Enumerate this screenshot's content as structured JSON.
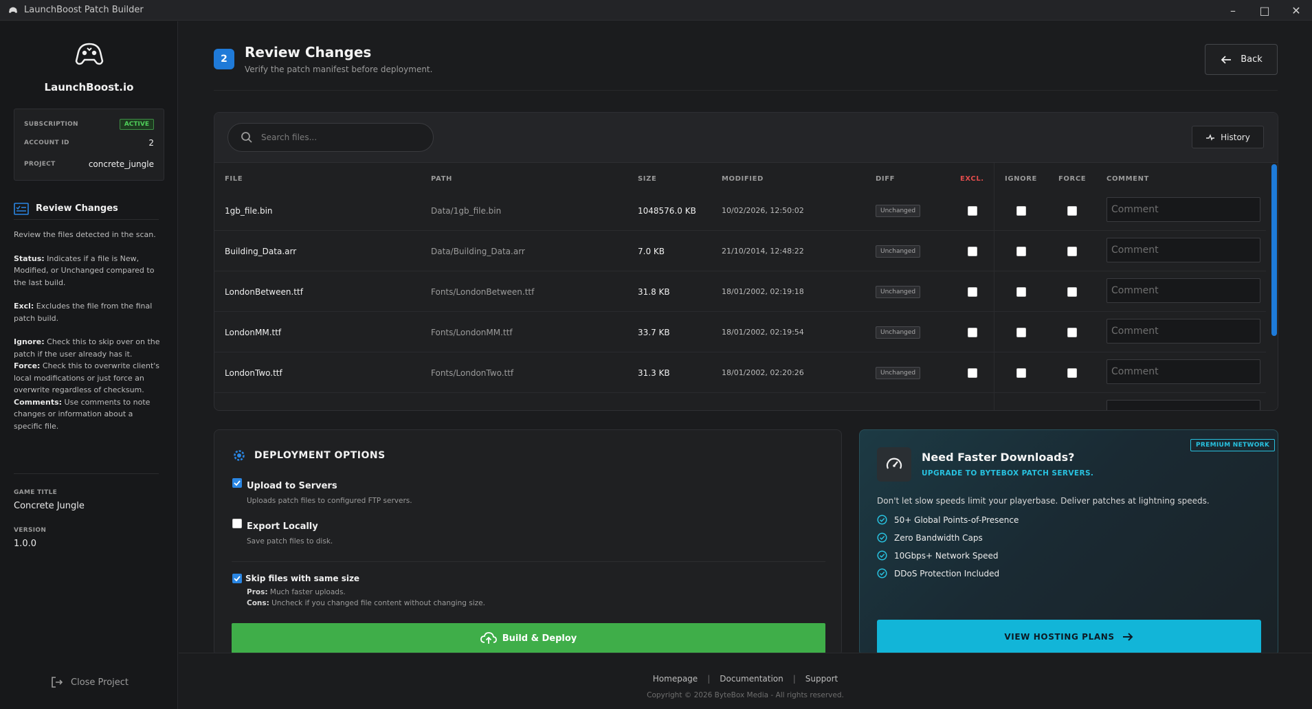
{
  "window": {
    "title": "LaunchBoost Patch Builder"
  },
  "sidebar": {
    "brand": "LaunchBoost.io",
    "subscription": {
      "label": "SUBSCRIPTION",
      "status": "ACTIVE"
    },
    "account": {
      "label": "ACCOUNT ID",
      "value": "2"
    },
    "project": {
      "label": "PROJECT",
      "value": "concrete_jungle"
    },
    "nav_active": "Review Changes",
    "help": {
      "intro": "Review the files detected in the scan.",
      "status_k": "Status:",
      "status_v": " Indicates if a file is New, Modified, or Unchanged compared to the last build.",
      "excl_k": "Excl:",
      "excl_v": " Excludes the file from the final patch build.",
      "ignore_k": "Ignore:",
      "ignore_v": " Check this to skip over on the patch if the user already has it.",
      "force_k": "Force:",
      "force_v": " Check this to overwrite client's local modifications or just force an overwrite regardless of checksum.",
      "comments_k": "Comments:",
      "comments_v": " Use comments to note changes or information about a specific file."
    },
    "game_title_label": "GAME TITLE",
    "game_title": "Concrete Jungle",
    "version_label": "VERSION",
    "version": "1.0.0",
    "close_project": "Close Project"
  },
  "header": {
    "step": "2",
    "title": "Review Changes",
    "subtitle": "Verify the patch manifest before deployment.",
    "back": "Back"
  },
  "files": {
    "search_placeholder": "Search files...",
    "history": "History",
    "columns": [
      "FILE",
      "PATH",
      "SIZE",
      "MODIFIED",
      "DIFF",
      "EXCL.",
      "IGNORE",
      "FORCE",
      "COMMENT"
    ],
    "comment_placeholder": "Comment",
    "rows": [
      {
        "file": "1gb_file.bin",
        "path": "Data/1gb_file.bin",
        "size": "1048576.0 KB",
        "modified": "10/02/2026, 12:50:02",
        "diff": "Unchanged"
      },
      {
        "file": "Building_Data.arr",
        "path": "Data/Building_Data.arr",
        "size": "7.0 KB",
        "modified": "21/10/2014, 12:48:22",
        "diff": "Unchanged"
      },
      {
        "file": "LondonBetween.ttf",
        "path": "Fonts/LondonBetween.ttf",
        "size": "31.8 KB",
        "modified": "18/01/2002, 02:19:18",
        "diff": "Unchanged"
      },
      {
        "file": "LondonMM.ttf",
        "path": "Fonts/LondonMM.ttf",
        "size": "33.7 KB",
        "modified": "18/01/2002, 02:19:54",
        "diff": "Unchanged"
      },
      {
        "file": "LondonTwo.ttf",
        "path": "Fonts/LondonTwo.ttf",
        "size": "31.3 KB",
        "modified": "18/01/2002, 02:20:26",
        "diff": "Unchanged"
      }
    ]
  },
  "deployment": {
    "title": "DEPLOYMENT OPTIONS",
    "upload": {
      "label": "Upload to Servers",
      "desc": "Uploads patch files to configured FTP servers.",
      "checked": true
    },
    "export": {
      "label": "Export Locally",
      "desc": "Save patch files to disk.",
      "checked": false
    },
    "skip": {
      "label": "Skip files with same size",
      "pros_k": "Pros:",
      "pros_v": " Much faster uploads.",
      "cons_k": "Cons:",
      "cons_v": " Uncheck if you changed file content without changing size.",
      "checked": true
    },
    "build": "Build & Deploy"
  },
  "promo": {
    "badge": "PREMIUM NETWORK",
    "title": "Need Faster Downloads?",
    "subtitle": "UPGRADE TO BYTEBOX PATCH SERVERS.",
    "desc": "Don't let slow speeds limit your playerbase. Deliver patches at lightning speeds.",
    "features": [
      "50+ Global Points-of-Presence",
      "Zero Bandwidth Caps",
      "10Gbps+ Network Speed",
      "DDoS Protection Included"
    ],
    "cta": "VIEW HOSTING PLANS"
  },
  "footer": {
    "links": [
      "Homepage",
      "Documentation",
      "Support"
    ],
    "copyright": "Copyright © 2026 ByteBox Media - All rights reserved."
  },
  "colors": {
    "accent": "#1f7ad8",
    "build": "#3fae49",
    "promo": "#12b5d8",
    "active": "#4fcf5a",
    "excl": "#e24c4c"
  }
}
